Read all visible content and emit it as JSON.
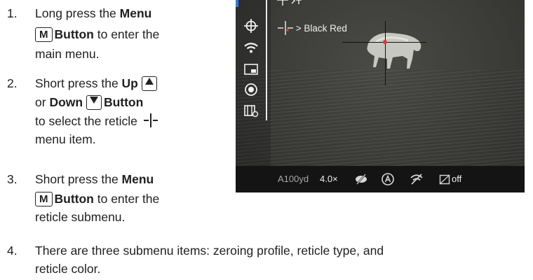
{
  "steps": [
    {
      "num": "1.",
      "l1a": "Long press the ",
      "l1b": "Menu",
      "key": "M",
      "l2b": "Button",
      "l2c": " to enter the",
      "l3": "main menu."
    },
    {
      "num": "2.",
      "l1a": "Short press the ",
      "l1b": "Up",
      "l2a": "or ",
      "l2b": "Down",
      "l2c": "Button",
      "l3": "to select the reticle",
      "l4": "menu item."
    },
    {
      "num": "3.",
      "l1a": "Short press the ",
      "l1b": "Menu",
      "key": "M",
      "l2b": "Button",
      "l2c": " to enter the",
      "l3": "reticle submenu."
    },
    {
      "num": "4.",
      "l1": "There are three submenu items: zeroing profile, reticle type, and",
      "l2": "reticle color."
    }
  ],
  "screen": {
    "menu_label": "> Black Red",
    "status": {
      "distance": "A100yd",
      "zoom": "4.0×",
      "pip_label": "off"
    },
    "sidebar_icons": [
      "crosshair-icon",
      "wifi-icon",
      "pip-icon",
      "camera-icon",
      "video-settings-icon"
    ],
    "colors": {
      "reticle_dot": "#d63c3c",
      "accent": "#2f7bd8"
    }
  }
}
